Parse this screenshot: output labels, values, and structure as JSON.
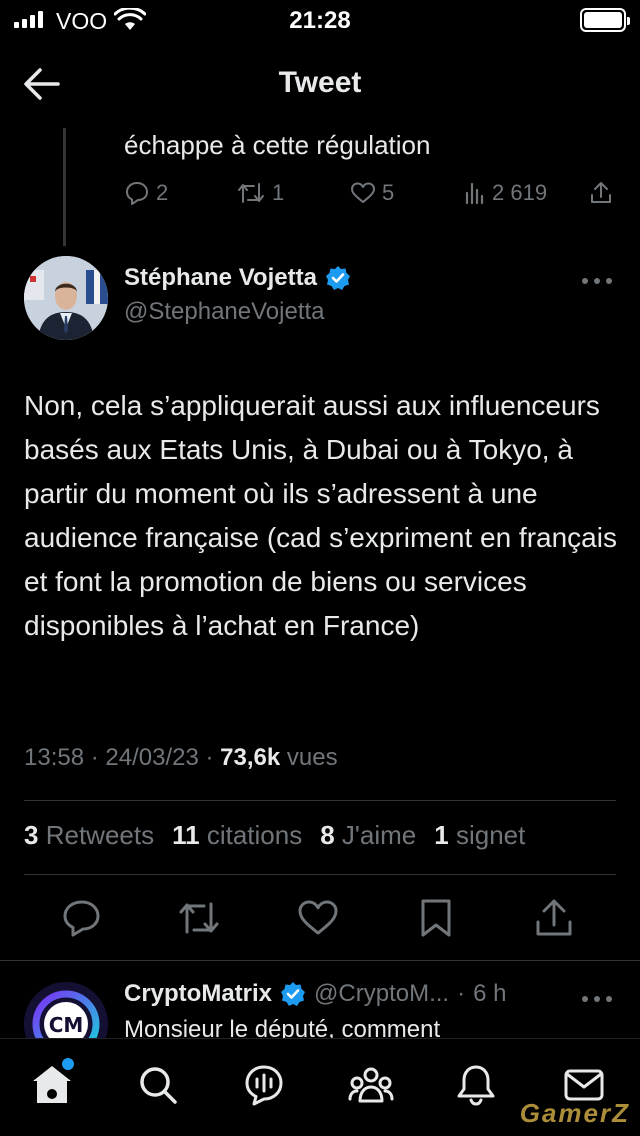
{
  "status_bar": {
    "carrier": "VOO",
    "time": "21:28"
  },
  "header": {
    "title": "Tweet"
  },
  "previous_tweet": {
    "text": "échappe à cette régulation",
    "replies": "2",
    "retweets": "1",
    "likes": "5",
    "views": "2 619"
  },
  "tweet": {
    "author_name": "Stéphane Vojetta",
    "author_handle": "@StephaneVojetta",
    "body": "Non, cela s’appliquerait aussi aux influenceurs basés aux Etats Unis, à Dubai ou à Tokyo, à partir du moment où ils s’adressent à une audience française (cad s’expriment en français et font la promotion de biens ou services disponibles à l’achat en France)",
    "time": "13:58",
    "date": "24/03/23",
    "views_count": "73,6k",
    "views_label": "vues",
    "stats": {
      "retweets_count": "3",
      "retweets_label": "Retweets",
      "quotes_count": "11",
      "quotes_label": "citations",
      "likes_count": "8",
      "likes_label": "J'aime",
      "bookmarks_count": "1",
      "bookmarks_label": "signet"
    }
  },
  "reply": {
    "author_name": "CryptoMatrix",
    "author_handle": "@CryptoM...",
    "age": "6 h",
    "text": "Monsieur le député, comment"
  },
  "colors": {
    "accent": "#1d9bf0",
    "text": "#e7e9ea",
    "muted": "#71767b",
    "background": "#000000"
  },
  "icons": [
    "back-arrow-icon",
    "reply-icon",
    "retweet-icon",
    "like-icon",
    "views-icon",
    "share-icon",
    "bookmark-icon",
    "verified-icon",
    "home-icon",
    "search-icon",
    "spaces-icon",
    "communities-icon",
    "notifications-icon",
    "messages-icon"
  ],
  "watermark": "GamerZ"
}
